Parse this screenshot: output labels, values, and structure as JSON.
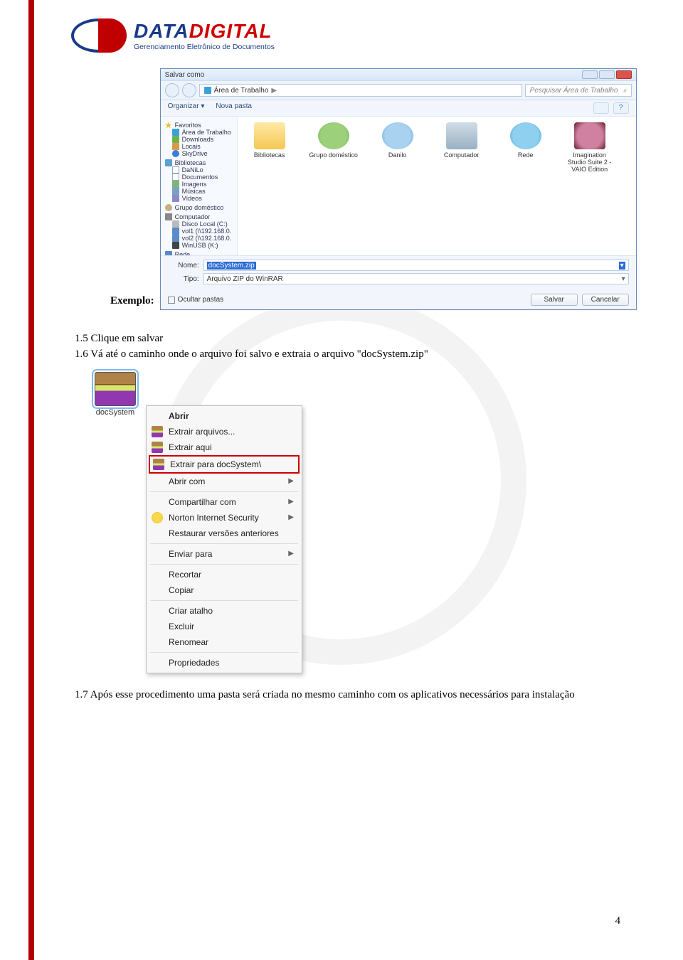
{
  "logo": {
    "text_navy": "DATA",
    "text_red": "DIGITAL",
    "tagline": "Gerenciamento Eletrônico de Documentos"
  },
  "example_label": "Exemplo:",
  "save_dialog": {
    "title": "Salvar como",
    "breadcrumb": "Área de Trabalho",
    "breadcrumb_arrow": "▶",
    "search_placeholder": "Pesquisar Área de Trabalho",
    "toolbar": {
      "organize": "Organizar ▾",
      "newfolder": "Nova pasta"
    },
    "help_icon": "?",
    "sidebar": {
      "favoritos": {
        "hdr": "Favoritos",
        "items": [
          "Área de Trabalho",
          "Downloads",
          "Locais",
          "SkyDrive"
        ]
      },
      "bibliotecas": {
        "hdr": "Bibliotecas",
        "items": [
          "DaNiLo",
          "Documentos",
          "Imagens",
          "Músicas",
          "Vídeos"
        ]
      },
      "grupo": {
        "hdr": "Grupo doméstico"
      },
      "computador": {
        "hdr": "Computador",
        "items": [
          "Disco Local (C:)",
          "vol1 (\\\\192.168.0.",
          "vol2 (\\\\192.168.0.",
          "WinUSB (K:)"
        ]
      },
      "rede": {
        "hdr": "Rede"
      }
    },
    "files": [
      "Bibliotecas",
      "Grupo doméstico",
      "Danilo",
      "Computador",
      "Rede",
      "Imagination Studio Suite 2 - VAIO Edition"
    ],
    "nome_label": "Nome:",
    "nome_value": "docSystem.zip",
    "tipo_label": "Tipo:",
    "tipo_value": "Arquivo ZIP do WinRAR",
    "ocultar": "Ocultar pastas",
    "salvar": "Salvar",
    "cancelar": "Cancelar"
  },
  "steps": {
    "s15": "1.5 Clique em salvar",
    "s16": "1.6 Vá até o caminho onde o arquivo foi salvo e extraia o arquivo \"docSystem.zip\""
  },
  "ctx": {
    "file_label": "docSystem",
    "items": {
      "abrir": "Abrir",
      "extrair_arquivos": "Extrair arquivos...",
      "extrair_aqui": "Extrair aqui",
      "extrair_para": "Extrair para docSystem\\",
      "abrir_com": "Abrir com",
      "compartilhar": "Compartilhar com",
      "norton": "Norton Internet Security",
      "restaurar": "Restaurar versões anteriores",
      "enviar": "Enviar para",
      "recortar": "Recortar",
      "copiar": "Copiar",
      "criar_atalho": "Criar atalho",
      "excluir": "Excluir",
      "renomear": "Renomear",
      "propriedades": "Propriedades"
    },
    "submenu_arrow": "▶"
  },
  "step17": "1.7 Após esse procedimento uma pasta será criada no mesmo caminho com os aplicativos necessários para instalação",
  "page_number": "4"
}
